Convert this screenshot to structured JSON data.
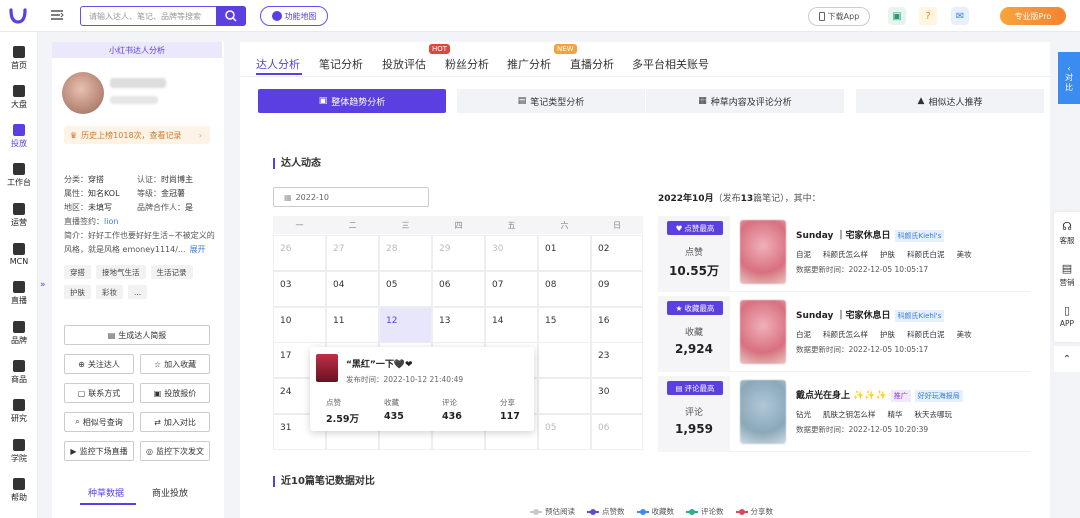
{
  "topbar": {
    "search_placeholder": "请输入达人、笔记、品牌等搜索",
    "func_map": "功能地图",
    "download_app": "下载App",
    "pro_label": "专业版Pro"
  },
  "nav": [
    "首页",
    "大盘",
    "投放",
    "工作台",
    "运营",
    "MCN",
    "直播",
    "品牌",
    "商品",
    "研究",
    "学院",
    "帮助"
  ],
  "nav_active": 2,
  "profile": {
    "panel_title": "小红书达人分析",
    "history": "历史上榜1018次，查看记录",
    "category_k": "分类：",
    "category_v": "穿搭",
    "cert_k": "认证：",
    "cert_v": "时尚博主",
    "attr_k": "属性：",
    "attr_v": "知名KOL",
    "level_k": "等级：",
    "level_v": "金冠薯",
    "region_k": "地区：",
    "region_v": "未填写",
    "brand_k": "品牌合作人：",
    "brand_v": "是",
    "live_k": "直播签约：",
    "live_v": "lion",
    "intro": "简介：好好工作也要好好生活~不被定义的",
    "intro2": "风格，就是风格 emoney1114/...",
    "expand": "展开",
    "tags": [
      "穿搭",
      "接地气生活",
      "生活记录",
      "护肤",
      "彩妆",
      "..."
    ],
    "gen_report": "生成达人简报",
    "follow": "关注达人",
    "collect": "加入收藏",
    "contact": "联系方式",
    "quote": "投放报价",
    "similar": "相似号查询",
    "compare": "加入对比",
    "monitor_live": "监控下场直播",
    "monitor_post": "监控下次发文",
    "tab_seed": "种草数据",
    "tab_biz": "商业投放"
  },
  "tabs": [
    {
      "label": "达人分析"
    },
    {
      "label": "笔记分析"
    },
    {
      "label": "投放评估",
      "badge": "HOT"
    },
    {
      "label": "粉丝分析"
    },
    {
      "label": "推广分析",
      "badge": "NEW"
    },
    {
      "label": "直播分析"
    },
    {
      "label": "多平台相关账号"
    }
  ],
  "subtabs": [
    "整体趋势分析",
    "笔记类型分析",
    "种草内容及评论分析",
    "相似达人推荐"
  ],
  "section1": "达人动态",
  "section2": "近10篇笔记数据对比",
  "date_value": "2022-10",
  "weekdays": [
    "一",
    "二",
    "三",
    "四",
    "五",
    "六",
    "日"
  ],
  "calendar": [
    [
      "26",
      "27",
      "28",
      "29",
      "30",
      "01",
      "02"
    ],
    [
      "03",
      "04",
      "05",
      "06",
      "07",
      "08",
      "09"
    ],
    [
      "10",
      "11",
      "12",
      "13",
      "14",
      "15",
      "16"
    ],
    [
      "17",
      "",
      "",
      "",
      "",
      "",
      "23"
    ],
    [
      "24",
      "",
      "",
      "",
      "",
      "",
      "30"
    ],
    [
      "31",
      "",
      "",
      "",
      "",
      "05",
      "06"
    ]
  ],
  "popup": {
    "title": "“黑红”一下🖤❤",
    "time": "发布时间：2022-10-12 21:40:49",
    "stats": [
      {
        "label": "点赞",
        "value": "2.59万"
      },
      {
        "label": "收藏",
        "value": "435"
      },
      {
        "label": "评论",
        "value": "436"
      },
      {
        "label": "分享",
        "value": "117"
      }
    ]
  },
  "month_summary": {
    "prefix": "2022年10月",
    "mid": "（发布",
    "count": "13",
    "suffix": "篇笔记），其中："
  },
  "cards": [
    {
      "badge": "点赞最高",
      "metric": "点赞",
      "value": "10.55万",
      "title": "Sunday ｜宅家休息日",
      "tags": [
        "科颜氏Kiehl's"
      ],
      "keys": [
        "自泥",
        "科颜氏怎么样",
        "护肤",
        "科颜氏白泥",
        "美妆"
      ],
      "date": "数据更新时间：2022-12-05 10:05:17"
    },
    {
      "badge": "收藏最高",
      "metric": "收藏",
      "value": "2,924",
      "title": "Sunday ｜宅家休息日",
      "tags": [
        "科颜氏Kiehl's"
      ],
      "keys": [
        "白泥",
        "科颜氏怎么样",
        "护肤",
        "科颜氏白泥",
        "美妆"
      ],
      "date": "数据更新时间：2022-12-05 10:05:17"
    },
    {
      "badge": "评论最高",
      "metric": "评论",
      "value": "1,959",
      "title": "戴点光在身上 ✨✨✨",
      "tags": [
        "推广",
        "好好玩海报局"
      ],
      "keys": [
        "钻光",
        "肌肤之钥怎么样",
        "精华",
        "秋天去哪玩"
      ],
      "date": "数据更新时间：2022-12-05 10:20:39"
    }
  ],
  "legend": [
    {
      "name": "预估阅读",
      "color": "#c8c8cc"
    },
    {
      "name": "点赞数",
      "color": "#5b4fd0"
    },
    {
      "name": "收藏数",
      "color": "#3b8cf0"
    },
    {
      "name": "评论数",
      "color": "#2bb08a"
    },
    {
      "name": "分享数",
      "color": "#e0465a"
    }
  ],
  "right_panel": "对比",
  "right_tools": [
    "客服",
    "营销",
    "APP"
  ]
}
